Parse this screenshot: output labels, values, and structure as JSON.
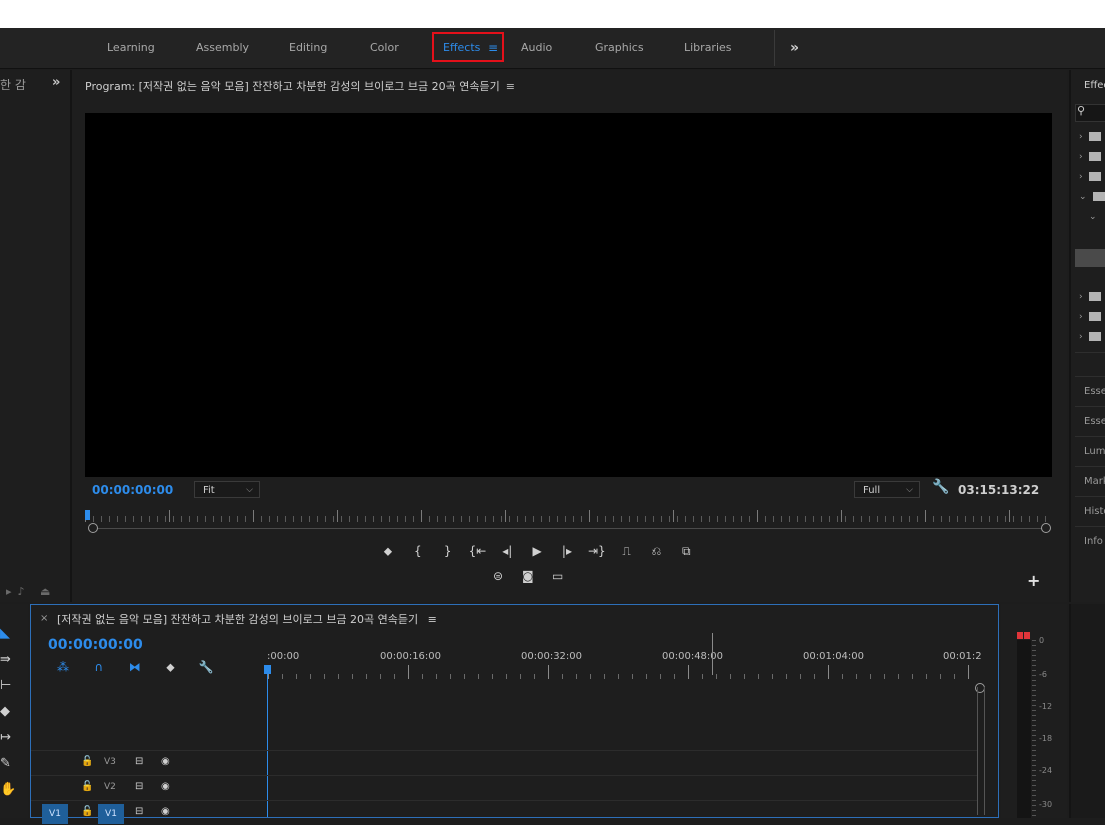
{
  "workspace_tabs": [
    {
      "label": "Learning"
    },
    {
      "label": "Assembly"
    },
    {
      "label": "Editing"
    },
    {
      "label": "Color"
    },
    {
      "label": "Effects",
      "active": true
    },
    {
      "label": "Audio"
    },
    {
      "label": "Graphics"
    },
    {
      "label": "Libraries"
    }
  ],
  "workspace_more": "»",
  "left_panel": {
    "title": "한 감",
    "more": "»"
  },
  "program": {
    "title": "Program: [저작권 없는 음악 모음] 잔잔하고 차분한 감성의 브이로그 브금 20곡 연속듣기",
    "menu_icon": "≡",
    "timecode_current": "00:00:00:00",
    "zoom_select": "Fit",
    "resolution_select": "Full",
    "timecode_duration": "03:15:13:22"
  },
  "effects_panel": {
    "title": "Effec",
    "side_items": [
      "Esse",
      "Esse",
      "Lum",
      "Mark",
      "Histo",
      "Info"
    ]
  },
  "timeline": {
    "close": "×",
    "title": "[저작권 없는 음악 모음] 잔잔하고 차분한 감성의 브이로그 브금 20곡 연속듣기",
    "menu_icon": "≡",
    "timecode": "00:00:00:00",
    "ruler_labels": [
      ":00:00",
      "00:00:16:00",
      "00:00:32:00",
      "00:00:48:00",
      "00:01:04:00",
      "00:01:2"
    ],
    "tracks": [
      {
        "name": "V3"
      },
      {
        "name": "V2"
      },
      {
        "name": "V1",
        "source": "V1"
      }
    ]
  },
  "meters": {
    "labels": [
      "0",
      "-6",
      "-12",
      "-18",
      "-24",
      "-30"
    ]
  },
  "colors": {
    "accent": "#2d8ceb",
    "highlight_box": "#e4101a",
    "clip_indicator": "#e0353a"
  }
}
